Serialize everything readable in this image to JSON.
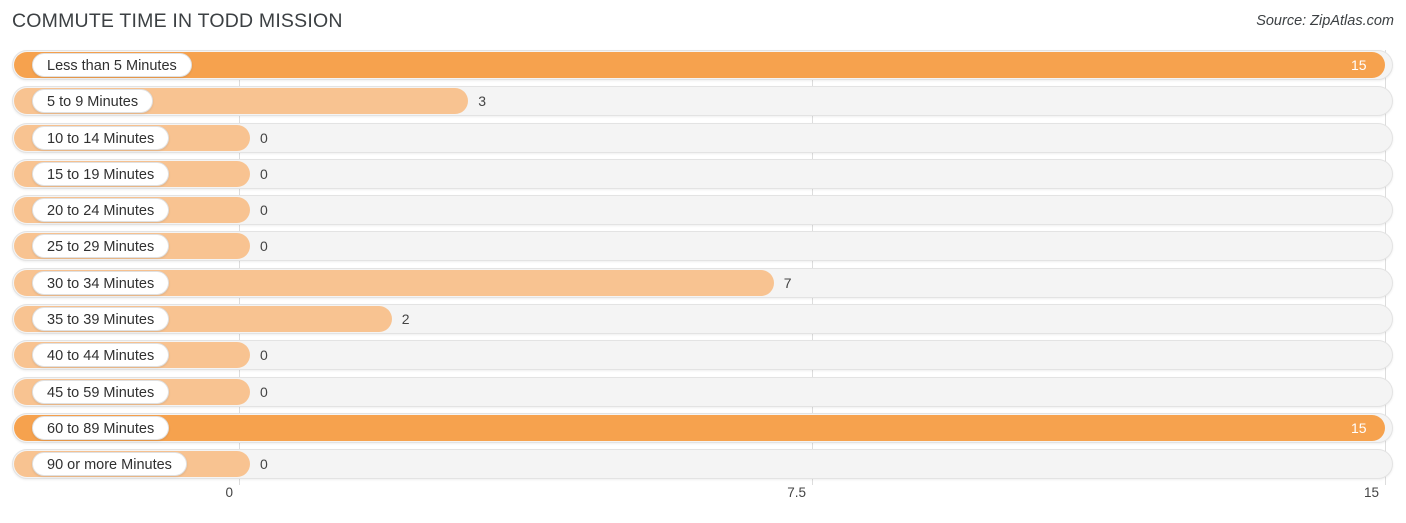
{
  "header": {
    "title": "COMMUTE TIME IN TODD MISSION",
    "source": "Source: ZipAtlas.com"
  },
  "axis": {
    "ticks": [
      "0",
      "7.5",
      "15"
    ],
    "tick_values": [
      0,
      7.5,
      15
    ],
    "min": 0,
    "max": 15
  },
  "colors": {
    "bar_light": "#f8c391",
    "bar_strong": "#f6a24e",
    "track": "#f4f4f4",
    "track_border": "#e3e3e3",
    "gridline": "#dddddd",
    "title_text": "#3c4043",
    "value_outside": "#444444",
    "value_inside": "#ffffff"
  },
  "chart_data": {
    "type": "bar",
    "orientation": "horizontal",
    "title": "COMMUTE TIME IN TODD MISSION",
    "subtitle": "",
    "xlabel": "",
    "ylabel": "",
    "xlim": [
      0,
      15
    ],
    "grid": true,
    "legend": "none",
    "xticks": [
      0,
      7.5,
      15
    ],
    "xticklabels": [
      "0",
      "7.5",
      "15"
    ],
    "categories": [
      "Less than 5 Minutes",
      "5 to 9 Minutes",
      "10 to 14 Minutes",
      "15 to 19 Minutes",
      "20 to 24 Minutes",
      "25 to 29 Minutes",
      "30 to 34 Minutes",
      "35 to 39 Minutes",
      "40 to 44 Minutes",
      "45 to 59 Minutes",
      "60 to 89 Minutes",
      "90 or more Minutes"
    ],
    "values": [
      15,
      3,
      0,
      0,
      0,
      0,
      7,
      2,
      0,
      0,
      15,
      0
    ],
    "value_labels": [
      "15",
      "3",
      "0",
      "0",
      "0",
      "0",
      "7",
      "2",
      "0",
      "0",
      "15",
      "0"
    ]
  },
  "rows": [
    {
      "label": "Less than 5 Minutes",
      "value": 15,
      "value_label": "15",
      "highlight": true,
      "label_inside": true
    },
    {
      "label": "5 to 9 Minutes",
      "value": 3,
      "value_label": "3",
      "highlight": false,
      "label_inside": false
    },
    {
      "label": "10 to 14 Minutes",
      "value": 0,
      "value_label": "0",
      "highlight": false,
      "label_inside": false
    },
    {
      "label": "15 to 19 Minutes",
      "value": 0,
      "value_label": "0",
      "highlight": false,
      "label_inside": false
    },
    {
      "label": "20 to 24 Minutes",
      "value": 0,
      "value_label": "0",
      "highlight": false,
      "label_inside": false
    },
    {
      "label": "25 to 29 Minutes",
      "value": 0,
      "value_label": "0",
      "highlight": false,
      "label_inside": false
    },
    {
      "label": "30 to 34 Minutes",
      "value": 7,
      "value_label": "7",
      "highlight": false,
      "label_inside": false
    },
    {
      "label": "35 to 39 Minutes",
      "value": 2,
      "value_label": "2",
      "highlight": false,
      "label_inside": false
    },
    {
      "label": "40 to 44 Minutes",
      "value": 0,
      "value_label": "0",
      "highlight": false,
      "label_inside": false
    },
    {
      "label": "45 to 59 Minutes",
      "value": 0,
      "value_label": "0",
      "highlight": false,
      "label_inside": false
    },
    {
      "label": "60 to 89 Minutes",
      "value": 15,
      "value_label": "15",
      "highlight": true,
      "label_inside": true
    },
    {
      "label": "90 or more Minutes",
      "value": 0,
      "value_label": "0",
      "highlight": false,
      "label_inside": false
    }
  ]
}
